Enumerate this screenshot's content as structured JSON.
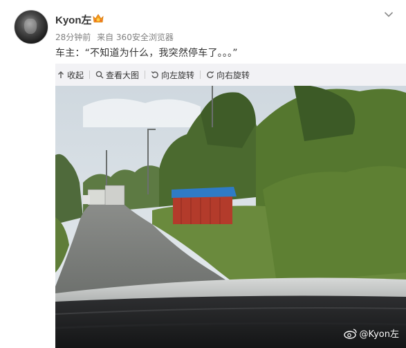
{
  "post": {
    "user_name": "Kyon左",
    "time": "28分钟前",
    "source": "来自 360安全浏览器",
    "text": "车主：“不知道为什么，我突然停车了。。。”"
  },
  "toolbar": {
    "collapse_label": "收起",
    "view_large_label": "查看大图",
    "rotate_left_label": "向左旋转",
    "rotate_right_label": "向右旋转"
  },
  "image": {
    "watermark": "@Kyon左"
  },
  "colors": {
    "text": "#333333",
    "meta": "#808080",
    "toolbar_bg": "#f2f2f5",
    "badge": "#f39a1e"
  }
}
